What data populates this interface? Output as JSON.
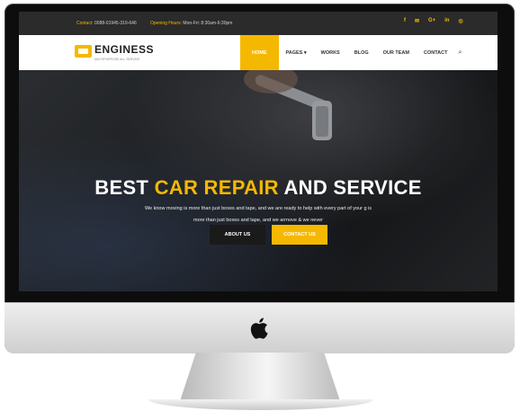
{
  "topbar": {
    "contact_label": "Contact:",
    "contact_value": "0088-01945-319-646",
    "hours_label": "Opening Hours:",
    "hours_value": "Mon-Fri: 8:30am-6:30pm",
    "socials": [
      "f",
      "✉",
      "G+",
      "in",
      "◎"
    ]
  },
  "brand": {
    "name": "ENGINESS",
    "tagline": "MULTIPURPOSE ALL SERVICE"
  },
  "nav": {
    "items": [
      "HOME",
      "PAGES ▾",
      "WORKS",
      "BLOG",
      "OUR TEAM",
      "CONTACT"
    ],
    "active": "HOME",
    "search_icon": "⌕"
  },
  "hero": {
    "title_part1": "BEST ",
    "title_highlight": "CAR REPAIR",
    "title_part2": " AND SERVICE",
    "subtitle_line1": "We know moving is more than just boxes and tape, and we are ready to help with every part of your g is",
    "subtitle_line2": "more than just boxes and tape, and we arrnove & we never",
    "button_about": "ABOUT US",
    "button_contact": "CONTACT US"
  },
  "colors": {
    "accent": "#f5b800",
    "topbar": "#2b2b2b",
    "dark_button": "#1a1a1a"
  }
}
